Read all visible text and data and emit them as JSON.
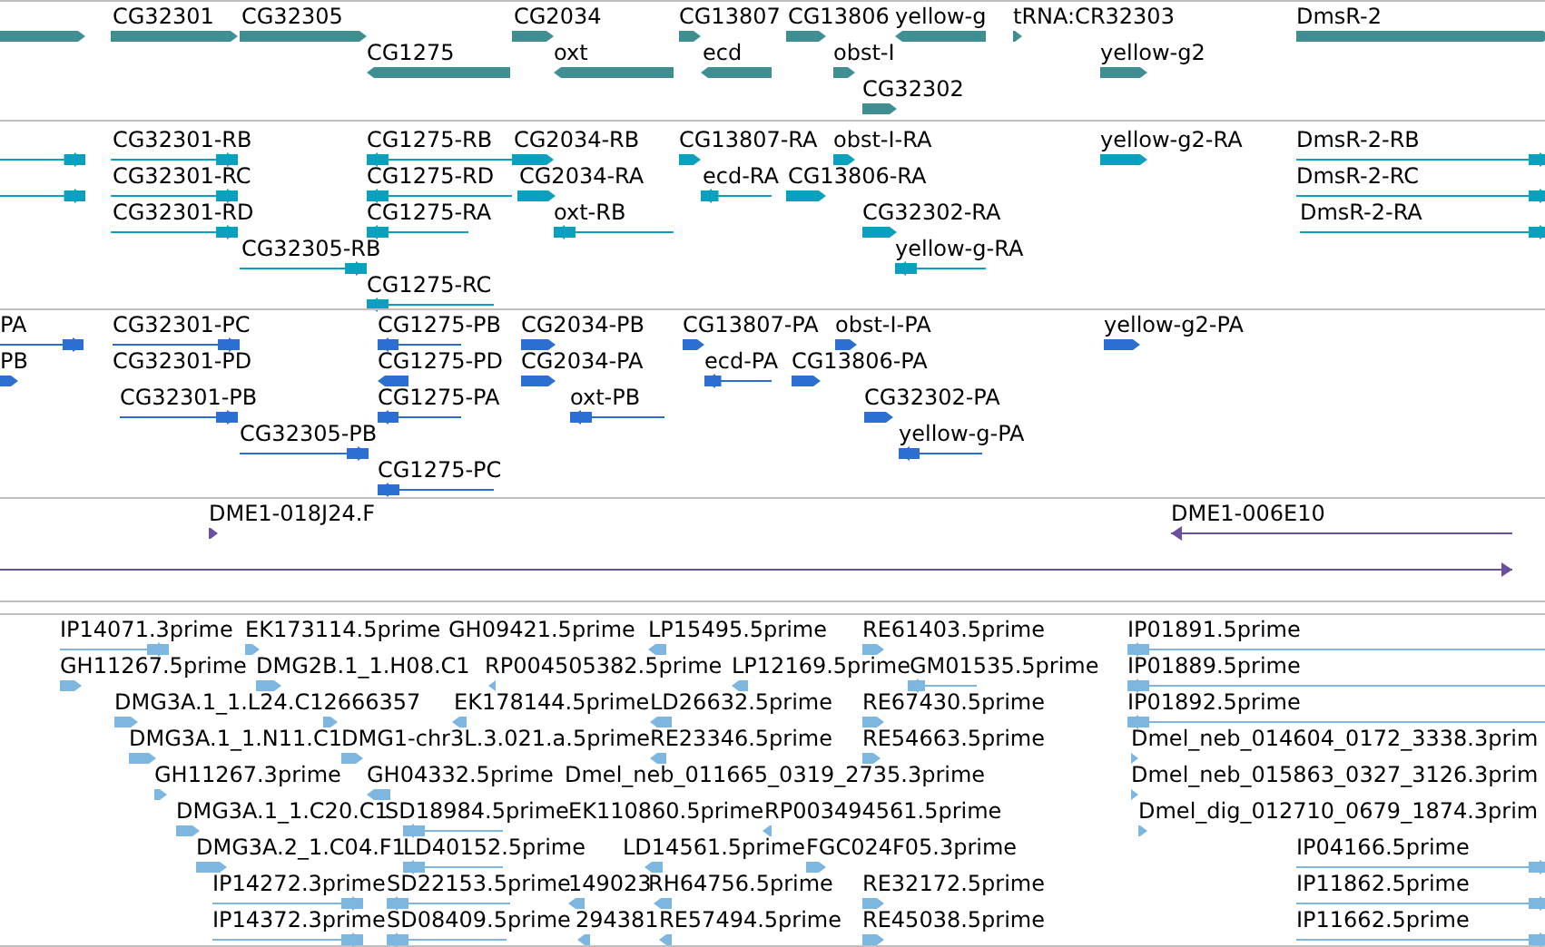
{
  "tracks": [
    {
      "kind": "gene",
      "color": "#3f8f92",
      "features": [
        {
          "reverse": false
        },
        {
          "label": "CG32301",
          "reverse": false
        },
        {
          "label": "CG32305",
          "reverse": false
        },
        {
          "label": "CG2034",
          "reverse": false
        },
        {
          "label": "CG13807",
          "reverse": false
        },
        {
          "label": "CG13806",
          "reverse": false
        },
        {
          "label": "yellow-g",
          "reverse": true
        },
        {
          "label": "tRNA:CR32303",
          "reverse": false
        },
        {
          "label": "DmsR-2",
          "reverse": false
        },
        {
          "label": "CG1275",
          "reverse": true
        },
        {
          "label": "oxt",
          "reverse": true
        },
        {
          "label": "ecd",
          "reverse": true
        },
        {
          "label": "obst-I",
          "reverse": false
        },
        {
          "label": "yellow-g2",
          "reverse": false
        },
        {
          "label": "CG32302",
          "reverse": false
        }
      ]
    },
    {
      "kind": "transcript",
      "color": "#0aa0bf",
      "features": [
        {
          "reverse": false
        },
        {
          "reverse": false
        },
        {
          "label": "CG32301-RB",
          "reverse": false
        },
        {
          "label": "CG32301-RC",
          "reverse": false
        },
        {
          "label": "CG32301-RD",
          "reverse": false
        },
        {
          "label": "CG32305-RB",
          "reverse": false
        },
        {
          "label": "CG1275-RB",
          "reverse": true
        },
        {
          "label": "CG2034-RB",
          "reverse": false
        },
        {
          "label": "CG1275-RD",
          "reverse": true
        },
        {
          "label": "CG2034-RA",
          "reverse": false
        },
        {
          "label": "CG1275-RA",
          "reverse": true
        },
        {
          "label": "oxt-RB",
          "reverse": true
        },
        {
          "label": "CG1275-RC",
          "reverse": true
        },
        {
          "label": "CG13807-RA",
          "reverse": false
        },
        {
          "label": "ecd-RA",
          "reverse": true
        },
        {
          "label": "obst-I-RA",
          "reverse": false
        },
        {
          "label": "CG13806-RA",
          "reverse": false
        },
        {
          "label": "CG32302-RA",
          "reverse": false
        },
        {
          "label": "yellow-g-RA",
          "reverse": true
        },
        {
          "label": "yellow-g2-RA",
          "reverse": false
        },
        {
          "label": "DmsR-2-RB",
          "reverse": false
        },
        {
          "label": "DmsR-2-RC",
          "reverse": false
        },
        {
          "label": "DmsR-2-RA",
          "reverse": false
        }
      ]
    },
    {
      "kind": "protein",
      "color": "#2a6fd1",
      "features": [
        {
          "label": "PA",
          "reverse": false
        },
        {
          "label": "PB",
          "reverse": false
        },
        {
          "label": "CG32301-PC",
          "reverse": false
        },
        {
          "label": "CG32301-PD"
        },
        {
          "label": "CG32301-PB",
          "reverse": false
        },
        {
          "label": "CG32305-PB",
          "reverse": false
        },
        {
          "label": "CG1275-PB",
          "reverse": true
        },
        {
          "label": "CG1275-PD",
          "reverse": true
        },
        {
          "label": "CG1275-PA",
          "reverse": true
        },
        {
          "label": "CG1275-PC",
          "reverse": true
        },
        {
          "label": "CG2034-PB",
          "reverse": false
        },
        {
          "label": "CG2034-PA",
          "reverse": false
        },
        {
          "label": "oxt-PB",
          "reverse": true
        },
        {
          "label": "CG13807-PA",
          "reverse": false
        },
        {
          "label": "obst-I-PA",
          "reverse": false
        },
        {
          "label": "ecd-PA",
          "reverse": true
        },
        {
          "label": "CG13806-PA",
          "reverse": false
        },
        {
          "label": "CG32302-PA",
          "reverse": false
        },
        {
          "label": "yellow-g-PA",
          "reverse": true
        },
        {
          "label": "yellow-g2-PA",
          "reverse": false
        }
      ]
    },
    {
      "kind": "clone",
      "color": "#6c4fa0",
      "features": [
        {
          "label": "DME1-018J24.F",
          "reverse": false
        },
        {
          "label": "DME1-006E10",
          "reverse": true
        },
        {
          "reverse": false
        }
      ]
    },
    {
      "kind": "est",
      "color": "#7db6de",
      "features": [
        {
          "label": "IP14071.3prime",
          "reverse": false
        },
        {
          "label": "EK173114.5prime",
          "reverse": false
        },
        {
          "label": "GH09421.5prime"
        },
        {
          "label": "LP15495.5prime",
          "reverse": true
        },
        {
          "label": "RE61403.5prime",
          "reverse": false
        },
        {
          "label": "IP01891.5prime",
          "reverse": true
        },
        {
          "label": "GH11267.5prime",
          "reverse": false
        },
        {
          "label": "DMG2B.1_1.H08.C1",
          "reverse": false
        },
        {
          "label": "RP004505382.5prime",
          "reverse": true
        },
        {
          "label": "LP12169.5prime",
          "reverse": true
        },
        {
          "label": "GM01535.5prime",
          "reverse": true
        },
        {
          "label": "IP01889.5prime",
          "reverse": true
        },
        {
          "label": "DMG3A.1_1.L24.C12666357",
          "reverse": false
        },
        {
          "reverse": false
        },
        {
          "label": "EK178144.5prime",
          "reverse": true
        },
        {
          "label": "LD26632.5prime",
          "reverse": true
        },
        {
          "label": "RE67430.5prime",
          "reverse": false
        },
        {
          "label": "IP01892.5prime",
          "reverse": true
        },
        {
          "label": "DMG3A.1_1.N11.C1",
          "reverse": false
        },
        {
          "label": "DMG1-chr3L.3.021.a.5prime",
          "reverse": false
        },
        {
          "label": "RE23346.5prime",
          "reverse": true
        },
        {
          "label": "RE54663.5prime",
          "reverse": false
        },
        {
          "label": "Dmel_neb_014604_0172_3338.3prim",
          "reverse": false
        },
        {
          "label": "GH11267.3prime",
          "reverse": false
        },
        {
          "label": "GH04332.5prime",
          "reverse": true
        },
        {
          "label": "Dmel_neb_011665_0319_2735.3prime"
        },
        {
          "label": "Dmel_neb_015863_0327_3126.3prim",
          "reverse": false
        },
        {
          "label": "DMG3A.1_1.C20.C1",
          "reverse": false
        },
        {
          "label": "SD18984.5prime",
          "reverse": true
        },
        {
          "label": "EK110860.5prime"
        },
        {
          "label": "RP003494561.5prime",
          "reverse": true
        },
        {
          "label": "Dmel_dig_012710_0679_1874.3prim",
          "reverse": false
        },
        {
          "label": "DMG3A.2_1.C04.F1",
          "reverse": false
        },
        {
          "label": "LD40152.5prime",
          "reverse": true
        },
        {
          "label": "LD14561.5prime",
          "reverse": true
        },
        {
          "label": "FGC024F05.3prime",
          "reverse": false
        },
        {
          "label": "IP04166.5prime",
          "reverse": false
        },
        {
          "label": "IP14272.3prime",
          "reverse": false
        },
        {
          "label": "SD22153.5prime",
          "reverse": true
        },
        {
          "label": "149023",
          "reverse": true
        },
        {
          "label": "RH64756.5prime",
          "reverse": true
        },
        {
          "label": "RE32172.5prime",
          "reverse": false
        },
        {
          "label": "IP11862.5prime",
          "reverse": false
        },
        {
          "label": "IP14372.3prime",
          "reverse": false
        },
        {
          "label": "SD08409.5prime",
          "reverse": true
        },
        {
          "label": "294381",
          "reverse": true
        },
        {
          "label": "RE57494.5prime",
          "reverse": true
        },
        {
          "label": "RE45038.5prime",
          "reverse": false
        },
        {
          "label": "IP11662.5prime",
          "reverse": false
        }
      ]
    }
  ]
}
